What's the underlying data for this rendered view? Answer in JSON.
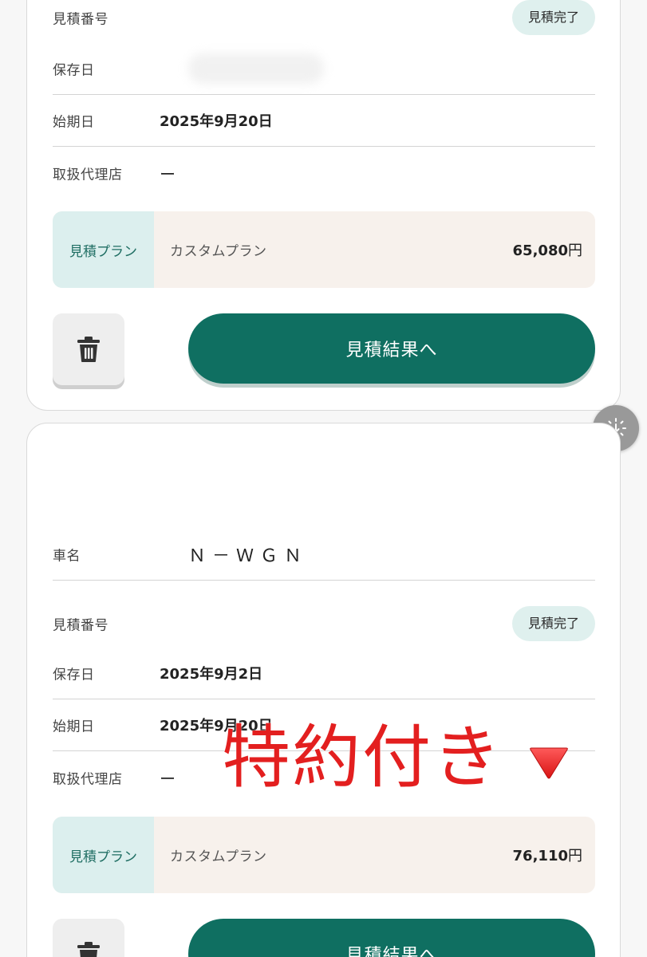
{
  "cards": [
    {
      "rows": {
        "quote_number_label": "見積番号",
        "status_badge": "見積完了",
        "saved_date_label": "保存日",
        "start_date_label": "始期日",
        "start_date_value": "2025年9月20日",
        "agency_label": "取扱代理店",
        "agency_value": "ー"
      },
      "plan": {
        "tag": "見積プラン",
        "name": "カスタムプラン",
        "price_number": "65,080",
        "price_unit": "円"
      },
      "button_label": "見積結果へ"
    },
    {
      "rows": {
        "car_name_label": "車名",
        "car_name_value": "Ｎ－ＷＧＮ",
        "quote_number_label": "見積番号",
        "status_badge": "見積完了",
        "saved_date_label": "保存日",
        "saved_date_value": "2025年9月2日",
        "start_date_label": "始期日",
        "start_date_value": "2025年9月20日",
        "agency_label": "取扱代理店",
        "agency_value": "ー"
      },
      "plan": {
        "tag": "見積プラン",
        "name": "カスタムプラン",
        "price_number": "76,110",
        "price_unit": "円"
      },
      "button_label": "見積結果へ"
    }
  ],
  "overlay": {
    "annotation_text": "特約付き",
    "triangle_icon": "red-triangle-down-icon",
    "text_color": "#e31f1f"
  },
  "icons": {
    "trash": "trash-icon",
    "side_action": "download-sparkle-icon"
  },
  "colors": {
    "primary": "#0f6f61",
    "badge_bg": "#dff0ee",
    "plan_tag_bg": "#dcefee",
    "plan_bg": "#f7f1ec"
  }
}
